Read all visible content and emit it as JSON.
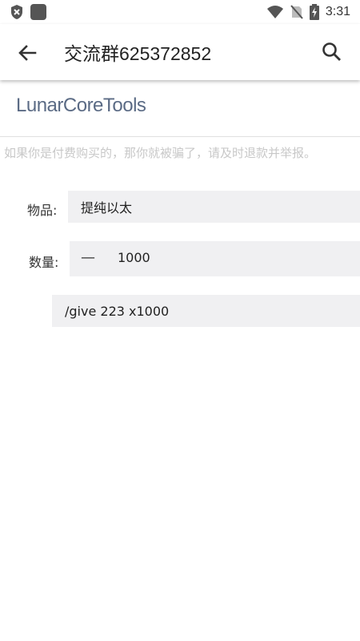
{
  "status_bar": {
    "time": "3:31",
    "icons": [
      "shield-x-icon",
      "app-icon",
      "wifi-icon",
      "no-sim-icon",
      "battery-charging-icon"
    ]
  },
  "toolbar": {
    "title": "交流群625372852",
    "back_icon": "arrow-left-icon",
    "search_icon": "search-icon"
  },
  "app": {
    "name": "LunarCoreTools",
    "notice": "如果你是付费购买的，那你就被骗了，请及时退款并举报。"
  },
  "form": {
    "item_label": "物品:",
    "item_value": "提纯以太",
    "quantity_label": "数量:",
    "minus_symbol": "—",
    "quantity_value": "1000",
    "command": "/give 223 x1000"
  }
}
